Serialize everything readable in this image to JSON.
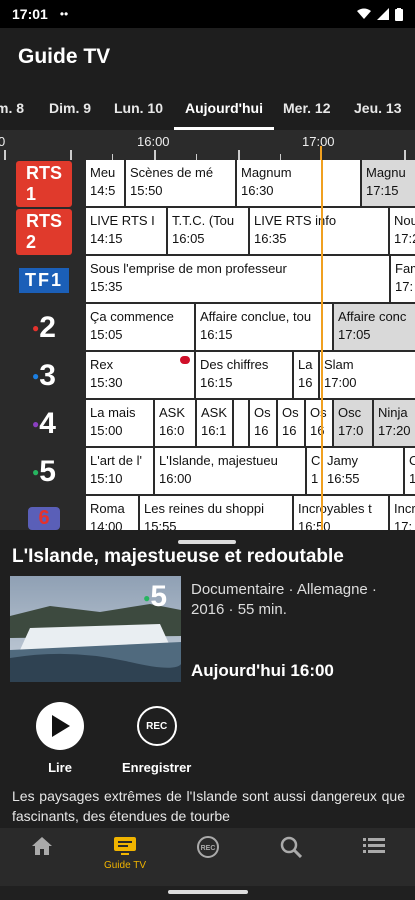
{
  "status": {
    "time": "17:01",
    "indicator": "••"
  },
  "app": {
    "title": "Guide TV"
  },
  "days": [
    {
      "label": "m. 8",
      "active": false
    },
    {
      "label": "Dim. 9",
      "active": false
    },
    {
      "label": "Lun. 10",
      "active": false
    },
    {
      "label": "Aujourd'hui",
      "active": true
    },
    {
      "label": "Mer. 12",
      "active": false
    },
    {
      "label": "Jeu. 13",
      "active": false
    }
  ],
  "timeline": {
    "labels": [
      "0",
      "16:00",
      "17:00"
    ]
  },
  "channels": [
    {
      "name": "RTS 1",
      "logo_text": "RTS 1",
      "color": "#e03a2c"
    },
    {
      "name": "RTS 2",
      "logo_text": "RTS 2",
      "color": "#e03a2c"
    },
    {
      "name": "TF1",
      "logo_text": "TF1",
      "color": "#1b5fb8"
    },
    {
      "name": "France 2",
      "logo_text": "2",
      "color": "#e5322d"
    },
    {
      "name": "France 3",
      "logo_text": "3",
      "color": "#1c7fe2"
    },
    {
      "name": "France 4",
      "logo_text": "4",
      "color": "#8a3fc1"
    },
    {
      "name": "France 5",
      "logo_text": "5",
      "color": "#27b560"
    },
    {
      "name": "M6",
      "logo_text": "6",
      "color": "#e5322d"
    }
  ],
  "grid": [
    [
      {
        "title": "Meu",
        "time": "14:5",
        "past": false
      },
      {
        "title": "Scènes de mé",
        "time": "15:50",
        "past": false
      },
      {
        "title": "Magnum",
        "time": "16:30",
        "past": false
      },
      {
        "title": "Magnu",
        "time": "17:15",
        "past": true
      }
    ],
    [
      {
        "title": "LIVE RTS I",
        "time": "14:15",
        "past": false
      },
      {
        "title": "T.T.C. (Tou",
        "time": "16:05",
        "past": false
      },
      {
        "title": "LIVE RTS info",
        "time": "16:35",
        "past": false
      },
      {
        "title": "Nou",
        "time": "17:2",
        "past": false
      }
    ],
    [
      {
        "title": "Sous l'emprise de mon professeur",
        "time": "15:35",
        "past": false
      },
      {
        "title": "Fam",
        "time": "17:",
        "past": false
      }
    ],
    [
      {
        "title": "Ça commence",
        "time": "15:05",
        "past": false
      },
      {
        "title": "Affaire conclue, tou",
        "time": "16:15",
        "past": false
      },
      {
        "title": "Affaire conc",
        "time": "17:05",
        "past": true
      }
    ],
    [
      {
        "title": "Rex",
        "time": "15:30",
        "past": false
      },
      {
        "title": "Des chiffres",
        "time": "16:15",
        "past": false
      },
      {
        "title": "La",
        "time": "16",
        "past": false
      },
      {
        "title": "Slam",
        "time": "17:00",
        "past": false
      }
    ],
    [
      {
        "title": "La mais",
        "time": "15:00",
        "past": false
      },
      {
        "title": "ASK",
        "time": "16:0",
        "past": false
      },
      {
        "title": "ASK",
        "time": "16:1",
        "past": false
      },
      {
        "title": "",
        "time": "",
        "past": false
      },
      {
        "title": "Os",
        "time": "16",
        "past": false
      },
      {
        "title": "Os",
        "time": "16",
        "past": false
      },
      {
        "title": "Os",
        "time": "16",
        "past": false
      },
      {
        "title": "Osc",
        "time": "17:0",
        "past": true
      },
      {
        "title": "Ninja",
        "time": "17:20",
        "past": true
      }
    ],
    [
      {
        "title": "L'art de l'",
        "time": "15:10",
        "past": false
      },
      {
        "title": "L'Islande, majestueu",
        "time": "16:00",
        "past": false
      },
      {
        "title": "C",
        "time": "1",
        "past": false
      },
      {
        "title": "Jamy",
        "time": "16:55",
        "past": false
      },
      {
        "title": "C",
        "time": "1",
        "past": false
      }
    ],
    [
      {
        "title": "Roma",
        "time": "14:00",
        "past": false
      },
      {
        "title": "Les reines du shoppi",
        "time": "15:55",
        "past": false
      },
      {
        "title": "Incroyables t",
        "time": "16:50",
        "past": false
      },
      {
        "title": "Incr",
        "time": "17:",
        "past": false
      }
    ]
  ],
  "detail": {
    "title": "L'Islande, majestueuse et redoutable",
    "channel_number": "5",
    "meta": "Documentaire · Allemagne · 2016 · 55 min.",
    "airtime": "Aujourd'hui 16:00",
    "play_label": "Lire",
    "record_label": "Enregistrer",
    "record_badge": "REC",
    "description": "Les paysages extrêmes de l'Islande sont aussi dangereux que fascinants, des étendues de tourbe"
  },
  "nav": [
    {
      "label": "",
      "icon": "home-icon",
      "active": false
    },
    {
      "label": "Guide TV",
      "icon": "tv-guide-icon",
      "active": true
    },
    {
      "label": "",
      "icon": "rec-icon",
      "active": false
    },
    {
      "label": "",
      "icon": "search-icon",
      "active": false
    },
    {
      "label": "",
      "icon": "list-icon",
      "active": false
    }
  ],
  "colors": {
    "accent": "#f0b400",
    "now_line": "#f0a020",
    "past_cell": "#d9d9d9"
  }
}
